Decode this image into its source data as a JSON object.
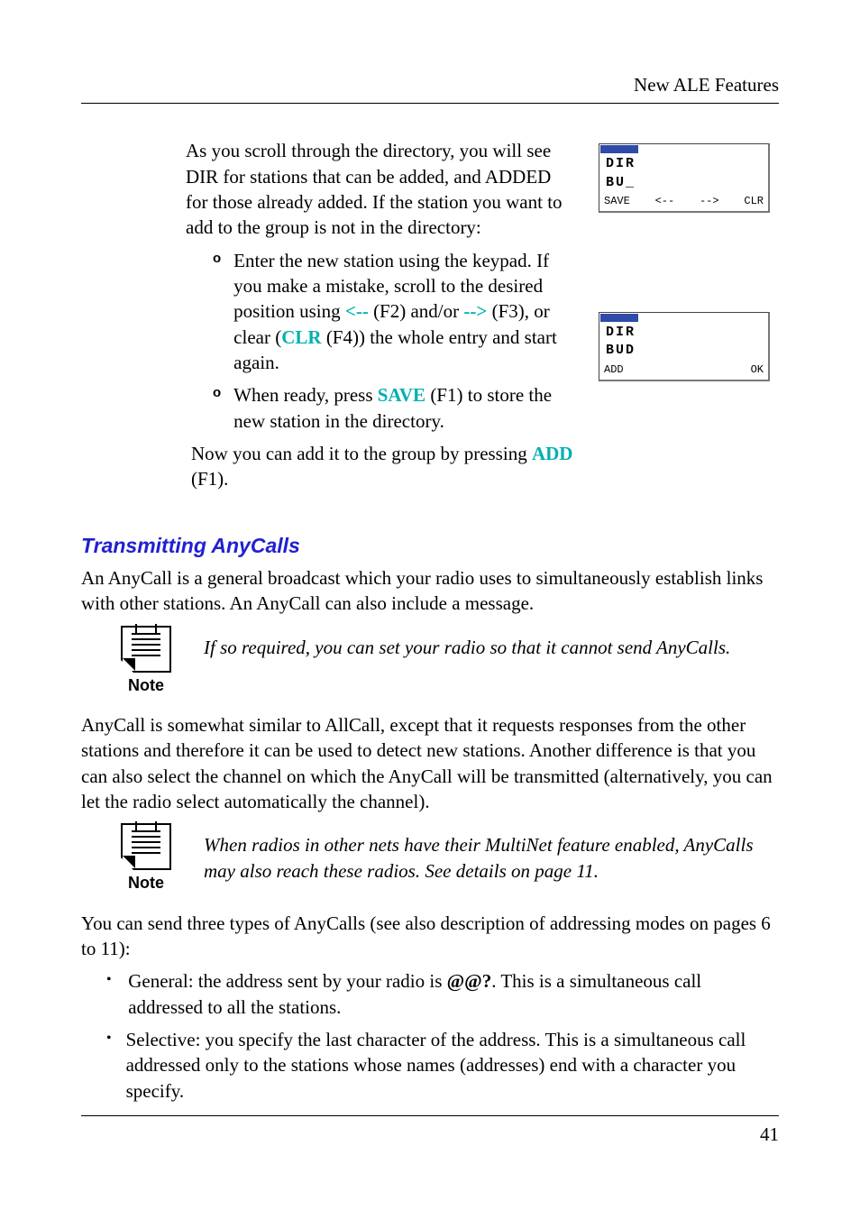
{
  "runningHead": "New ALE Features",
  "scroll_intro": "As you scroll through the directory, you will see DIR for stations that can be added, and ADDED for those already added. If the station you want to add to the group is not in the directory:",
  "o1_a": "Enter the new station using the keypad. If you make a mistake, scroll to the desired position using ",
  "o1_left": "<--",
  "o1_b": " (F2) and/or ",
  "o1_right": "-->",
  "o1_c": " (F3), or clear (",
  "o1_clr": "CLR",
  "o1_d": " (F4)) the whole entry and start again.",
  "o2_a": "When ready, press ",
  "o2_save": "SAVE",
  "o2_b": " (F1) to store the new station in the directory.",
  "now_a": "Now you can add it to the group by pressing ",
  "now_add": "ADD",
  "now_b": " (F1).",
  "h2": "Transmitting AnyCalls",
  "any_intro": "An AnyCall is a general broadcast which your radio uses to simultaneously establish links with other stations. An AnyCall can also include a message.",
  "note1": "If so required, you can set your radio so that it cannot send AnyCalls.",
  "any_para2": "AnyCall is somewhat similar to AllCall, except that it requests responses from the other stations and therefore it can be used to detect new stations. Another difference is that you can also select the channel on which the AnyCall will be transmitted (alternatively, you can let the radio select automatically the channel).",
  "note2": "When radios in other nets have their MultiNet feature enabled, AnyCalls may also reach these radios. See details on page 11.",
  "types_intro": "You can send three types of AnyCalls (see also description of addressing modes on pages 6 to 11):",
  "b1_a": "General: the address sent by your radio is ",
  "b1_addr": "@@?",
  "b1_b": ". This is a simultaneous call addressed to all the stations.",
  "b2": "Selective: you specify the last character of the address. This is a simultaneous call addressed only to the stations whose names (addresses) end with a character you specify.",
  "noteLabel": "Note",
  "pageNumber": "41",
  "lcd1": {
    "line1": "DIR",
    "line2": "BU_",
    "soft": [
      "SAVE",
      "<--",
      "-->",
      "CLR"
    ]
  },
  "lcd2": {
    "line1": "DIR",
    "line2": "BUD",
    "soft": [
      "ADD",
      "",
      "",
      "OK"
    ]
  }
}
